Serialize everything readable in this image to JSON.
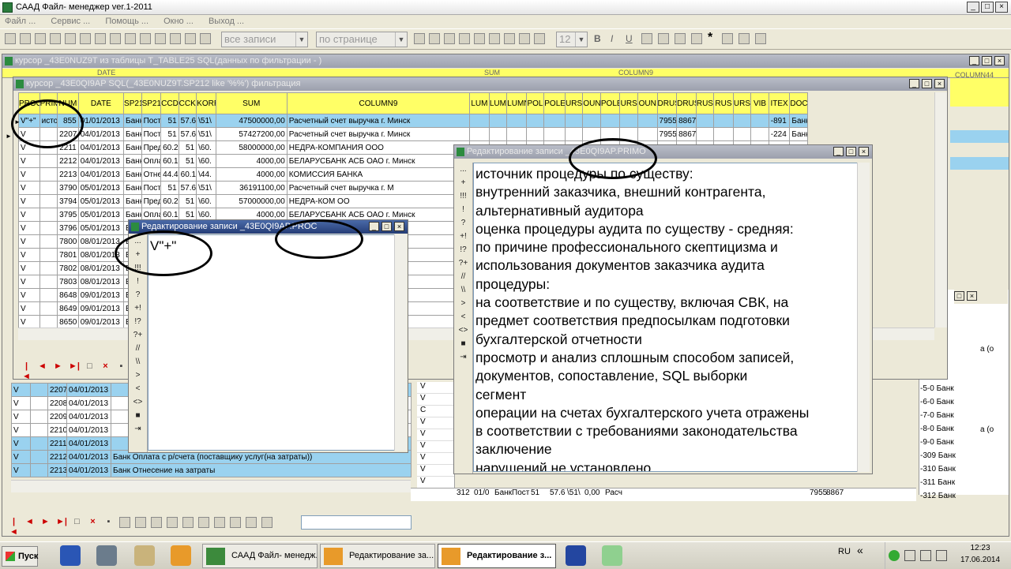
{
  "app": {
    "title": "СААД Файл- менеджер ver.1-2011"
  },
  "menu": [
    "Файл ...",
    "Сервис ...",
    "Помощь ...",
    "Окно ...",
    "Выход ..."
  ],
  "toolbar": {
    "filter_combo": "все записи",
    "page_combo": "по странице",
    "font_size": "12"
  },
  "cursor_window": {
    "title": "курсор _43E0NUZ9T из таблицы T_TABLE25 SQL(данных по фильтрации - )",
    "hidden_headers": [
      "DATE",
      "SUM",
      "COLUMN9",
      "COLUMN44"
    ]
  },
  "filter_window": {
    "title": "курсор _43E0QI9AP SQL(_43E0NUZ9T.SP212 like '%%') фильтрация",
    "headers": [
      "PROC",
      "PRIMO",
      "NUM",
      "DATE",
      "SP211",
      "SP212",
      "CCDT",
      "CCKT",
      "KORR",
      "SUM",
      "COLUMN9",
      "LUM",
      "LUM",
      "LUMN",
      "POL",
      "POLE",
      "URS",
      "OUN",
      "POLE",
      "URS",
      "OUN",
      "DRUS",
      "DRUS",
      "RUS",
      "RUS",
      "URS",
      "VIB",
      "ITEX",
      "DOC"
    ],
    "rows": [
      {
        "proc": "V\"+\"",
        "primo": "исто",
        "num": "855",
        "date": "01/01/2013",
        "sp211": "Банк",
        "sp212": "Посту",
        "ccdt": "51",
        "cckt": "57.6",
        "korr": "\\51\\",
        "sum": "47500000,00",
        "col9": "Расчетный счет выручка г. Минск",
        "drus": "7955",
        "drus2": "8867",
        "itex": "-891",
        "doc": "Банк"
      },
      {
        "proc": "V",
        "primo": "",
        "num": "2207",
        "date": "04/01/2013",
        "sp211": "Банк",
        "sp212": "Посту",
        "ccdt": "51",
        "cckt": "57.6",
        "korr": "\\51\\",
        "sum": "57427200,00",
        "col9": "Расчетный счет выручка г. Минск",
        "drus": "7955",
        "drus2": "8867",
        "itex": "-224",
        "doc": "Банк"
      },
      {
        "proc": "V",
        "primo": "",
        "num": "2211",
        "date": "04/01/2013",
        "sp211": "Банк",
        "sp212": "Пред",
        "ccdt": "60.2",
        "cckt": "51",
        "korr": "\\60.",
        "sum": "58000000,00",
        "col9": "НЕДРА-КОМПАНИЯ ООО",
        "drus": "",
        "drus2": "",
        "itex": "",
        "doc": ""
      },
      {
        "proc": "V",
        "primo": "",
        "num": "2212",
        "date": "04/01/2013",
        "sp211": "Банк",
        "sp212": "Опла",
        "ccdt": "60.1",
        "cckt": "51",
        "korr": "\\60.",
        "sum": "4000,00",
        "col9": "БЕЛАРУСБАНК АСБ ОАО г. Минск",
        "drus": "",
        "drus2": "",
        "itex": "",
        "doc": ""
      },
      {
        "proc": "V",
        "primo": "",
        "num": "2213",
        "date": "04/01/2013",
        "sp211": "Банк",
        "sp212": "Отне",
        "ccdt": "44.4",
        "cckt": "60.1",
        "korr": "\\44.",
        "sum": "4000,00",
        "col9": "КОМИССИЯ БАНКА",
        "drus": "",
        "drus2": "",
        "itex": "",
        "doc": ""
      },
      {
        "proc": "V",
        "primo": "",
        "num": "3790",
        "date": "05/01/2013",
        "sp211": "Банк",
        "sp212": "Посту",
        "ccdt": "51",
        "cckt": "57.6",
        "korr": "\\51\\",
        "sum": "36191100,00",
        "col9": "Расчетный счет выручка г. М",
        "drus": "",
        "drus2": "",
        "itex": "",
        "doc": ""
      },
      {
        "proc": "V",
        "primo": "",
        "num": "3794",
        "date": "05/01/2013",
        "sp211": "Банк",
        "sp212": "Пред",
        "ccdt": "60.2",
        "cckt": "51",
        "korr": "\\60.",
        "sum": "57000000,00",
        "col9": "НЕДРА-КОМ ОО",
        "drus": "",
        "drus2": "",
        "itex": "",
        "doc": ""
      },
      {
        "proc": "V",
        "primo": "",
        "num": "3795",
        "date": "05/01/2013",
        "sp211": "Банк",
        "sp212": "Опла",
        "ccdt": "60.1",
        "cckt": "51",
        "korr": "\\60.",
        "sum": "4000,00",
        "col9": "БЕЛАРУСБАНК АСБ ОАО г. Минск",
        "drus": "",
        "drus2": "",
        "itex": "",
        "doc": ""
      },
      {
        "proc": "V",
        "primo": "",
        "num": "3796",
        "date": "05/01/2013",
        "sp211": "Б",
        "sp212": "",
        "ccdt": "",
        "cckt": "",
        "korr": "",
        "sum": "",
        "col9": "",
        "drus": "",
        "drus2": "",
        "itex": "",
        "doc": ""
      },
      {
        "proc": "V",
        "primo": "",
        "num": "7800",
        "date": "08/01/2013",
        "sp211": "Б",
        "sp212": "",
        "ccdt": "",
        "cckt": "",
        "korr": "",
        "sum": "",
        "col9": "",
        "drus": "",
        "drus2": "",
        "itex": "",
        "doc": ""
      },
      {
        "proc": "V",
        "primo": "",
        "num": "7801",
        "date": "08/01/2013",
        "sp211": "Б",
        "sp212": "",
        "ccdt": "",
        "cckt": "",
        "korr": "",
        "sum": "",
        "col9": "",
        "drus": "",
        "drus2": "",
        "itex": "",
        "doc": ""
      },
      {
        "proc": "V",
        "primo": "",
        "num": "7802",
        "date": "08/01/2013",
        "sp211": "Б",
        "sp212": "",
        "ccdt": "",
        "cckt": "",
        "korr": "",
        "sum": "",
        "col9": "к",
        "drus": "",
        "drus2": "",
        "itex": "",
        "doc": ""
      },
      {
        "proc": "V",
        "primo": "",
        "num": "7803",
        "date": "08/01/2013",
        "sp211": "Б",
        "sp212": "",
        "ccdt": "",
        "cckt": "",
        "korr": "",
        "sum": "",
        "col9": "",
        "drus": "",
        "drus2": "",
        "itex": "",
        "doc": ""
      },
      {
        "proc": "V",
        "primo": "",
        "num": "8648",
        "date": "09/01/2013",
        "sp211": "Б",
        "sp212": "",
        "ccdt": "",
        "cckt": "",
        "korr": "",
        "sum": "",
        "col9": "к",
        "drus": "",
        "drus2": "",
        "itex": "",
        "doc": ""
      },
      {
        "proc": "V",
        "primo": "",
        "num": "8649",
        "date": "09/01/2013",
        "sp211": "Б",
        "sp212": "",
        "ccdt": "",
        "cckt": "",
        "korr": "",
        "sum": "",
        "col9": "к",
        "drus": "",
        "drus2": "",
        "itex": "",
        "doc": ""
      },
      {
        "proc": "V",
        "primo": "",
        "num": "8650",
        "date": "09/01/2013",
        "sp211": "Б",
        "sp212": "",
        "ccdt": "",
        "cckt": "",
        "korr": "",
        "sum": "",
        "col9": "к",
        "drus": "",
        "drus2": "",
        "itex": "",
        "doc": ""
      }
    ]
  },
  "lower_rows": [
    {
      "proc": "V",
      "num": "2207",
      "date": "04/01/2013",
      "text": "",
      "sel": true
    },
    {
      "proc": "V",
      "num": "2208",
      "date": "04/01/2013",
      "text": "",
      "sel": false
    },
    {
      "proc": "V",
      "num": "2209",
      "date": "04/01/2013",
      "text": "",
      "sel": false
    },
    {
      "proc": "V",
      "num": "2210",
      "date": "04/01/2013",
      "text": "",
      "sel": false
    },
    {
      "proc": "V",
      "num": "2211",
      "date": "04/01/2013",
      "text": "",
      "sel": true
    },
    {
      "proc": "V",
      "num": "2212",
      "date": "04/01/2013",
      "text": "Банк Оплата с р/счета (поставщику услуг(на затраты))",
      "sel": true
    },
    {
      "proc": "V",
      "num": "2213",
      "date": "04/01/2013",
      "text": "Банк Отнесение на затраты",
      "sel": true
    }
  ],
  "proc_editor": {
    "title": "Редактирование записи _43E0QI9AP.PROC",
    "value": "V\"+\"",
    "side_buttons": [
      "...",
      "+",
      "!!!",
      "!",
      "?",
      "+!",
      "!?",
      "?+",
      "//",
      "\\\\",
      ">",
      "<",
      "<>"
    ]
  },
  "primo_editor": {
    "title": "Редактирование записи _43E0QI9AP.PRIMO",
    "side_buttons": [
      "...",
      "+",
      "!!!",
      "!",
      "?",
      "+!",
      "!?",
      "?+",
      "//",
      "\\\\",
      ">",
      "<",
      "<>"
    ],
    "lines": [
      "источник процедуры по существу:",
      "внутренний заказчика, внешний контрагента,",
      "альтернативный аудитора",
      "оценка процедуры аудита по существу - средняя:",
      "по причине профессионального скептицизма и",
      "использования документов заказчика аудита",
      "процедуры:",
      "на соответствие и по существу, включая СВК, на",
      "предмет соответствия предпосылкам подготовки",
      "бухгалтерской отчетности",
      "просмотр и анализ сплошным способом записей,",
      "документов, сопоставление, SQL выборки",
      "сегмент",
      "операции на счетах бухгалтерского учета отражены",
      "в соответствии с требованиями законодательства",
      "заключение",
      "нарушений не установлено"
    ]
  },
  "mid_column_v": [
    "V",
    "V",
    "C",
    "V",
    "V",
    "V",
    "V",
    "V",
    "V",
    "V"
  ],
  "mid_row": {
    "num": "312",
    "date": "01/0",
    "a": "Банк",
    "b": "Пост",
    "c": "51",
    "d": "57.6",
    "e": "\\51\\",
    "f": "0,00",
    "g": "Расч",
    "h": "7955",
    "i": "8867"
  },
  "right_values": [
    "-5-0",
    "-6-0",
    "-7-0",
    "-8-0",
    "-9-0",
    "-309",
    "-310",
    "-311",
    "-312"
  ],
  "right_doc": [
    "Банк",
    "Банк",
    "Банк",
    "Банк",
    "Банк",
    "Банк",
    "Банк",
    "Банк",
    "Банк"
  ],
  "right_extra": [
    "а (о",
    "а (о"
  ],
  "taskbar": {
    "start": "Пуск",
    "buttons": [
      "СААД Файл- менедж...",
      "Редактирование за...",
      "Редактирование з..."
    ],
    "lang": "RU",
    "time": "12:23",
    "date": "17.06.2014"
  }
}
